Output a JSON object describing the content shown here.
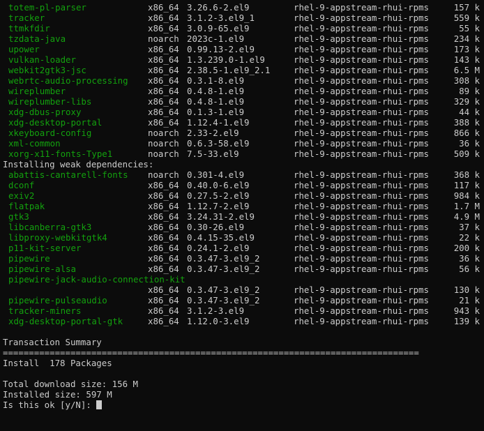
{
  "colors": {
    "background": "#0c0c0c",
    "foreground": "#cccccc",
    "package_name": "#13a10e"
  },
  "packages": [
    {
      "name": "totem-pl-parser",
      "arch": "x86_64",
      "version": "3.26.6-2.el9",
      "repo": "rhel-9-appstream-rhui-rpms",
      "size": "157 k"
    },
    {
      "name": "tracker",
      "arch": "x86_64",
      "version": "3.1.2-3.el9_1",
      "repo": "rhel-9-appstream-rhui-rpms",
      "size": "559 k"
    },
    {
      "name": "ttmkfdir",
      "arch": "x86_64",
      "version": "3.0.9-65.el9",
      "repo": "rhel-9-appstream-rhui-rpms",
      "size": "55 k"
    },
    {
      "name": "tzdata-java",
      "arch": "noarch",
      "version": "2023c-1.el9",
      "repo": "rhel-9-appstream-rhui-rpms",
      "size": "234 k"
    },
    {
      "name": "upower",
      "arch": "x86_64",
      "version": "0.99.13-2.el9",
      "repo": "rhel-9-appstream-rhui-rpms",
      "size": "173 k"
    },
    {
      "name": "vulkan-loader",
      "arch": "x86_64",
      "version": "1.3.239.0-1.el9",
      "repo": "rhel-9-appstream-rhui-rpms",
      "size": "143 k"
    },
    {
      "name": "webkit2gtk3-jsc",
      "arch": "x86_64",
      "version": "2.38.5-1.el9_2.1",
      "repo": "rhel-9-appstream-rhui-rpms",
      "size": "6.5 M"
    },
    {
      "name": "webrtc-audio-processing",
      "arch": "x86_64",
      "version": "0.3.1-8.el9",
      "repo": "rhel-9-appstream-rhui-rpms",
      "size": "308 k"
    },
    {
      "name": "wireplumber",
      "arch": "x86_64",
      "version": "0.4.8-1.el9",
      "repo": "rhel-9-appstream-rhui-rpms",
      "size": "89 k"
    },
    {
      "name": "wireplumber-libs",
      "arch": "x86_64",
      "version": "0.4.8-1.el9",
      "repo": "rhel-9-appstream-rhui-rpms",
      "size": "329 k"
    },
    {
      "name": "xdg-dbus-proxy",
      "arch": "x86_64",
      "version": "0.1.3-1.el9",
      "repo": "rhel-9-appstream-rhui-rpms",
      "size": "44 k"
    },
    {
      "name": "xdg-desktop-portal",
      "arch": "x86_64",
      "version": "1.12.4-1.el9",
      "repo": "rhel-9-appstream-rhui-rpms",
      "size": "388 k"
    },
    {
      "name": "xkeyboard-config",
      "arch": "noarch",
      "version": "2.33-2.el9",
      "repo": "rhel-9-appstream-rhui-rpms",
      "size": "866 k"
    },
    {
      "name": "xml-common",
      "arch": "noarch",
      "version": "0.6.3-58.el9",
      "repo": "rhel-9-appstream-rhui-rpms",
      "size": "36 k"
    },
    {
      "name": "xorg-x11-fonts-Type1",
      "arch": "noarch",
      "version": "7.5-33.el9",
      "repo": "rhel-9-appstream-rhui-rpms",
      "size": "509 k"
    }
  ],
  "weak_deps_header": "Installing weak dependencies:",
  "weak_deps": [
    {
      "name": "abattis-cantarell-fonts",
      "arch": "noarch",
      "version": "0.301-4.el9",
      "repo": "rhel-9-appstream-rhui-rpms",
      "size": "368 k"
    },
    {
      "name": "dconf",
      "arch": "x86_64",
      "version": "0.40.0-6.el9",
      "repo": "rhel-9-appstream-rhui-rpms",
      "size": "117 k"
    },
    {
      "name": "exiv2",
      "arch": "x86_64",
      "version": "0.27.5-2.el9",
      "repo": "rhel-9-appstream-rhui-rpms",
      "size": "984 k"
    },
    {
      "name": "flatpak",
      "arch": "x86_64",
      "version": "1.12.7-2.el9",
      "repo": "rhel-9-appstream-rhui-rpms",
      "size": "1.7 M"
    },
    {
      "name": "gtk3",
      "arch": "x86_64",
      "version": "3.24.31-2.el9",
      "repo": "rhel-9-appstream-rhui-rpms",
      "size": "4.9 M"
    },
    {
      "name": "libcanberra-gtk3",
      "arch": "x86_64",
      "version": "0.30-26.el9",
      "repo": "rhel-9-appstream-rhui-rpms",
      "size": "37 k"
    },
    {
      "name": "libproxy-webkitgtk4",
      "arch": "x86_64",
      "version": "0.4.15-35.el9",
      "repo": "rhel-9-appstream-rhui-rpms",
      "size": "22 k"
    },
    {
      "name": "p11-kit-server",
      "arch": "x86_64",
      "version": "0.24.1-2.el9",
      "repo": "rhel-9-appstream-rhui-rpms",
      "size": "200 k"
    },
    {
      "name": "pipewire",
      "arch": "x86_64",
      "version": "0.3.47-3.el9_2",
      "repo": "rhel-9-appstream-rhui-rpms",
      "size": "36 k"
    },
    {
      "name": "pipewire-alsa",
      "arch": "x86_64",
      "version": "0.3.47-3.el9_2",
      "repo": "rhel-9-appstream-rhui-rpms",
      "size": "56 k"
    },
    {
      "name": "pipewire-jack-audio-connection-kit",
      "arch": "",
      "version": "",
      "repo": "",
      "size": ""
    },
    {
      "name": "",
      "arch": "x86_64",
      "version": "0.3.47-3.el9_2",
      "repo": "rhel-9-appstream-rhui-rpms",
      "size": "130 k"
    },
    {
      "name": "pipewire-pulseaudio",
      "arch": "x86_64",
      "version": "0.3.47-3.el9_2",
      "repo": "rhel-9-appstream-rhui-rpms",
      "size": "21 k"
    },
    {
      "name": "tracker-miners",
      "arch": "x86_64",
      "version": "3.1.2-3.el9",
      "repo": "rhel-9-appstream-rhui-rpms",
      "size": "943 k"
    },
    {
      "name": "xdg-desktop-portal-gtk",
      "arch": "x86_64",
      "version": "1.12.0-3.el9",
      "repo": "rhel-9-appstream-rhui-rpms",
      "size": "139 k"
    }
  ],
  "summary": {
    "title": "Transaction Summary",
    "separator": "================================================================================",
    "install_line": "Install  178 Packages",
    "download_size": "Total download size: 156 M",
    "installed_size": "Installed size: 597 M",
    "prompt": "Is this ok [y/N]: "
  }
}
